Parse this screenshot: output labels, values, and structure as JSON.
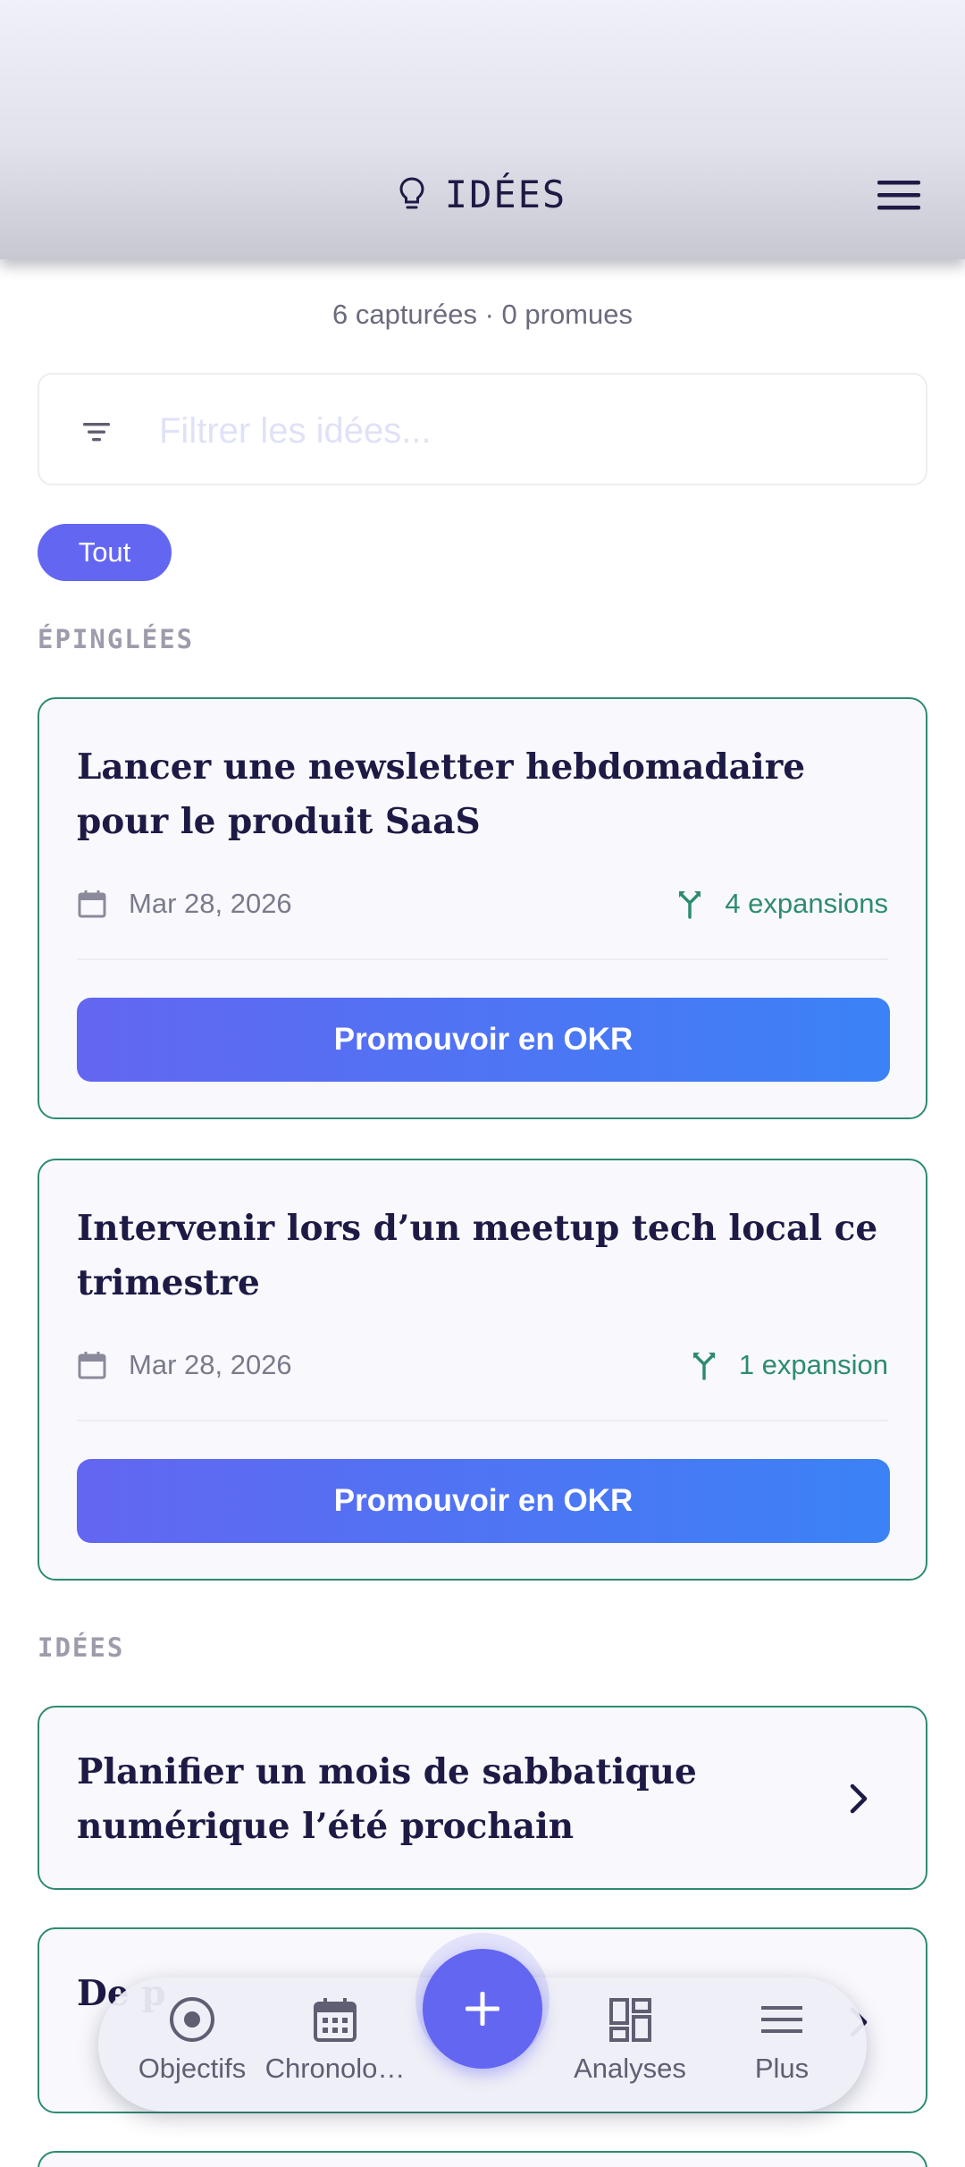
{
  "header": {
    "title": "IDÉES"
  },
  "stats": {
    "summary": "6 capturées · 0 promues"
  },
  "search": {
    "placeholder": "Filtrer les idées..."
  },
  "filters": {
    "active": "Tout"
  },
  "sections": {
    "pinned": "ÉPINGLÉES",
    "ideas": "IDÉES"
  },
  "pinned_cards": [
    {
      "title": "Lancer une newsletter hebdomadaire pour le produit SaaS",
      "date": "Mar 28, 2026",
      "expansions": "4 expansions",
      "action": "Promouvoir en OKR"
    },
    {
      "title": "Intervenir lors d’un meetup tech local ce trimestre",
      "date": "Mar 28, 2026",
      "expansions": "1 expansion",
      "action": "Promouvoir en OKR"
    }
  ],
  "idea_cards": [
    {
      "title": "Planifier un mois de sabbatique numérique l’été prochain"
    },
    {
      "title": "De p"
    }
  ],
  "nav": {
    "items": [
      "Objectifs",
      "Chronolo…",
      "Analyses",
      "Plus"
    ]
  },
  "colors": {
    "accent": "#6366f1",
    "accent_end": "#3b82f6",
    "green": "#2e8b72",
    "text": "#1d1a45"
  }
}
